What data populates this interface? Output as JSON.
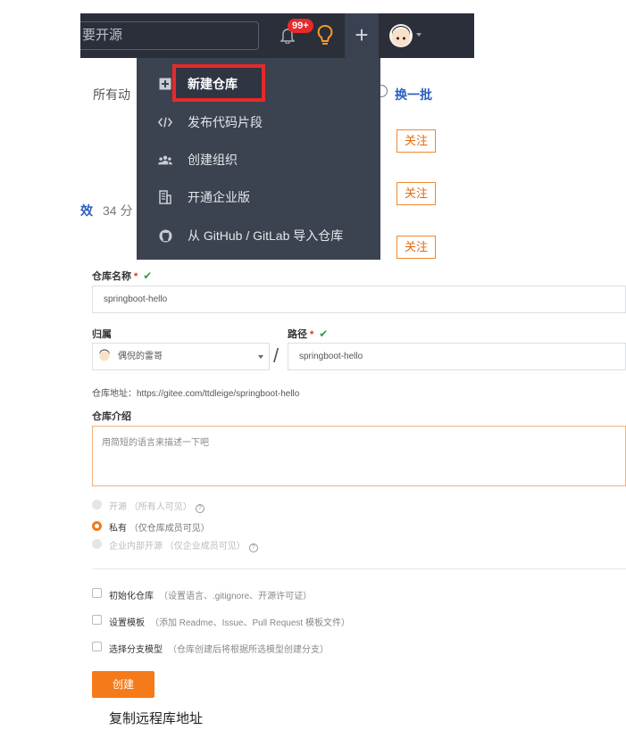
{
  "header": {
    "search_text": "要开源",
    "notification_badge": "99+",
    "plus_symbol": "+"
  },
  "background": {
    "activity_tab": "所有动",
    "refresh_label": "换一批",
    "stats_prefix": "效",
    "stats_text": "34 分",
    "follow_labels": [
      "关注",
      "关注",
      "关注"
    ]
  },
  "dropdown": {
    "items": [
      {
        "icon": "plus-square-icon",
        "label": "新建仓库"
      },
      {
        "icon": "code-icon",
        "label": "发布代码片段"
      },
      {
        "icon": "group-icon",
        "label": "创建组织"
      },
      {
        "icon": "building-icon",
        "label": "开通企业版"
      },
      {
        "icon": "github-icon",
        "label": "从 GitHub / GitLab 导入仓库"
      }
    ]
  },
  "form": {
    "repo_name_label": "仓库名称",
    "repo_name_value": "springboot-hello",
    "owner_label": "归属",
    "owner_value": "偶倪的雷哥",
    "path_label": "路径",
    "path_value": "springboot-hello",
    "separator": "/",
    "repo_url": "仓库地址：https://gitee.com/ttdleige/springboot-hello",
    "intro_label": "仓库介绍",
    "intro_placeholder": "用简短的语言来描述一下吧",
    "visibility": [
      {
        "label": "开源",
        "hint": "（所有人可见）",
        "checked": false,
        "disabled": true,
        "has_help": true
      },
      {
        "label": "私有",
        "hint": "（仅仓库成员可见）",
        "checked": true,
        "disabled": false,
        "has_help": false
      },
      {
        "label": "企业内部开源",
        "hint": "（仅企业成员可见）",
        "checked": false,
        "disabled": true,
        "has_help": true
      }
    ],
    "options": [
      {
        "label": "初始化仓库",
        "hint": "（设置语言、.gitignore、开源许可证）"
      },
      {
        "label": "设置模板",
        "hint": "（添加 Readme、Issue、Pull Request 模板文件）"
      },
      {
        "label": "选择分支模型",
        "hint": "（仓库创建后将根据所选模型创建分支）"
      }
    ],
    "create_button": "创建"
  },
  "caption": "复制远程库地址",
  "colors": {
    "header_bg": "#2b2f3a",
    "dropdown_bg": "#3b4250",
    "accent_orange": "#f57a1a",
    "highlight_red": "#e52a2a",
    "valid_green": "#2e9a4a"
  }
}
